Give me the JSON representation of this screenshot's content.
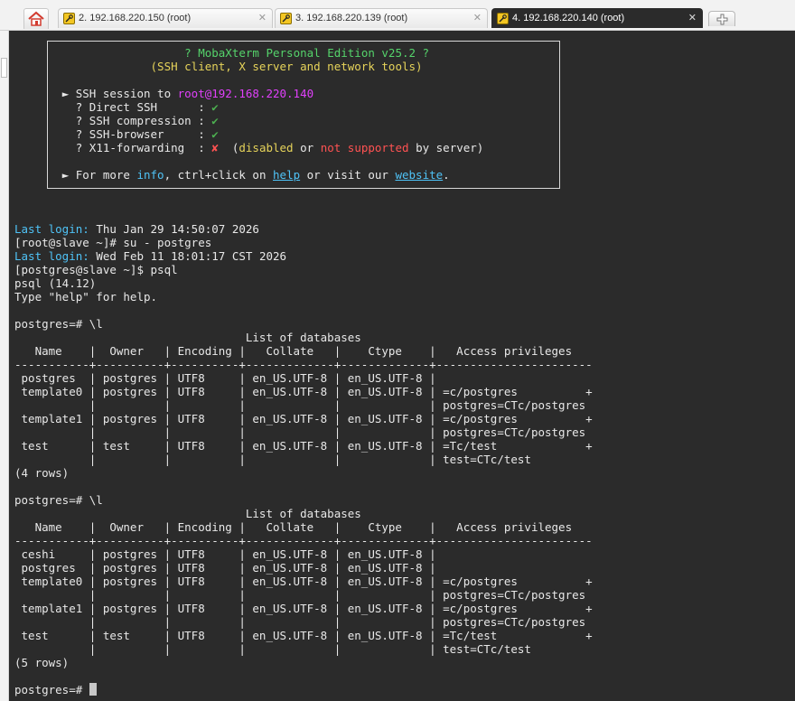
{
  "tabs": [
    {
      "label": "2. 192.168.220.150 (root)",
      "close": "✕"
    },
    {
      "label": "3. 192.168.220.139 (root)",
      "close": "✕"
    },
    {
      "label": "4. 192.168.220.140 (root)",
      "close": "✕"
    }
  ],
  "banner": {
    "title": "? MobaXterm Personal Edition v25.2 ?",
    "subtitle": "(SSH client, X server and network tools)",
    "session_prefix": "► SSH session to ",
    "session_host": "root@192.168.220.140",
    "features": [
      {
        "label": "  ? Direct SSH      : ",
        "status": "✔"
      },
      {
        "label": "  ? SSH compression : ",
        "status": "✔"
      },
      {
        "label": "  ? SSH-browser     : ",
        "status": "✔"
      },
      {
        "label": "  ? X11-forwarding  : ",
        "status": "✘"
      }
    ],
    "x11_note_1": "  (",
    "x11_disabled": "disabled",
    "x11_or": " or ",
    "x11_not_supported": "not supported",
    "x11_by": " by server)",
    "more_1": "► For more ",
    "more_info": "info",
    "more_2": ", ctrl+click on ",
    "more_help": "help",
    "more_3": " or visit our ",
    "more_website": "website",
    "more_4": "."
  },
  "session": {
    "last_login_label": "Last login:",
    "last_login_1": " Thu Jan 29 14:50:07 2026",
    "cmd_su": "[root@slave ~]# su - postgres",
    "last_login_2": " Wed Feb 11 18:01:17 CST 2026",
    "cmd_psql": "[postgres@slave ~]$ psql",
    "psql_version": "psql (14.12)",
    "help_hint": "Type \"help\" for help."
  },
  "query1": {
    "prompt": "postgres=# \\l",
    "lines": [
      "                                  List of databases",
      "   Name    |  Owner   | Encoding |   Collate   |    Ctype    |   Access privileges",
      "-----------+----------+----------+-------------+-------------+-----------------------",
      " postgres  | postgres | UTF8     | en_US.UTF-8 | en_US.UTF-8 |",
      " template0 | postgres | UTF8     | en_US.UTF-8 | en_US.UTF-8 | =c/postgres          +",
      "           |          |          |             |             | postgres=CTc/postgres",
      " template1 | postgres | UTF8     | en_US.UTF-8 | en_US.UTF-8 | =c/postgres          +",
      "           |          |          |             |             | postgres=CTc/postgres",
      " test      | test     | UTF8     | en_US.UTF-8 | en_US.UTF-8 | =Tc/test             +",
      "           |          |          |             |             | test=CTc/test",
      "(4 rows)"
    ]
  },
  "query2": {
    "prompt": "postgres=# \\l",
    "lines": [
      "                                  List of databases",
      "   Name    |  Owner   | Encoding |   Collate   |    Ctype    |   Access privileges",
      "-----------+----------+----------+-------------+-------------+-----------------------",
      " ceshi     | postgres | UTF8     | en_US.UTF-8 | en_US.UTF-8 |",
      " postgres  | postgres | UTF8     | en_US.UTF-8 | en_US.UTF-8 |",
      " template0 | postgres | UTF8     | en_US.UTF-8 | en_US.UTF-8 | =c/postgres          +",
      "           |          |          |             |             | postgres=CTc/postgres",
      " template1 | postgres | UTF8     | en_US.UTF-8 | en_US.UTF-8 | =c/postgres          +",
      "           |          |          |             |             | postgres=CTc/postgres",
      " test      | test     | UTF8     | en_US.UTF-8 | en_US.UTF-8 | =Tc/test             +",
      "           |          |          |             |             | test=CTc/test",
      "(5 rows)"
    ]
  },
  "final_prompt": "postgres=# "
}
